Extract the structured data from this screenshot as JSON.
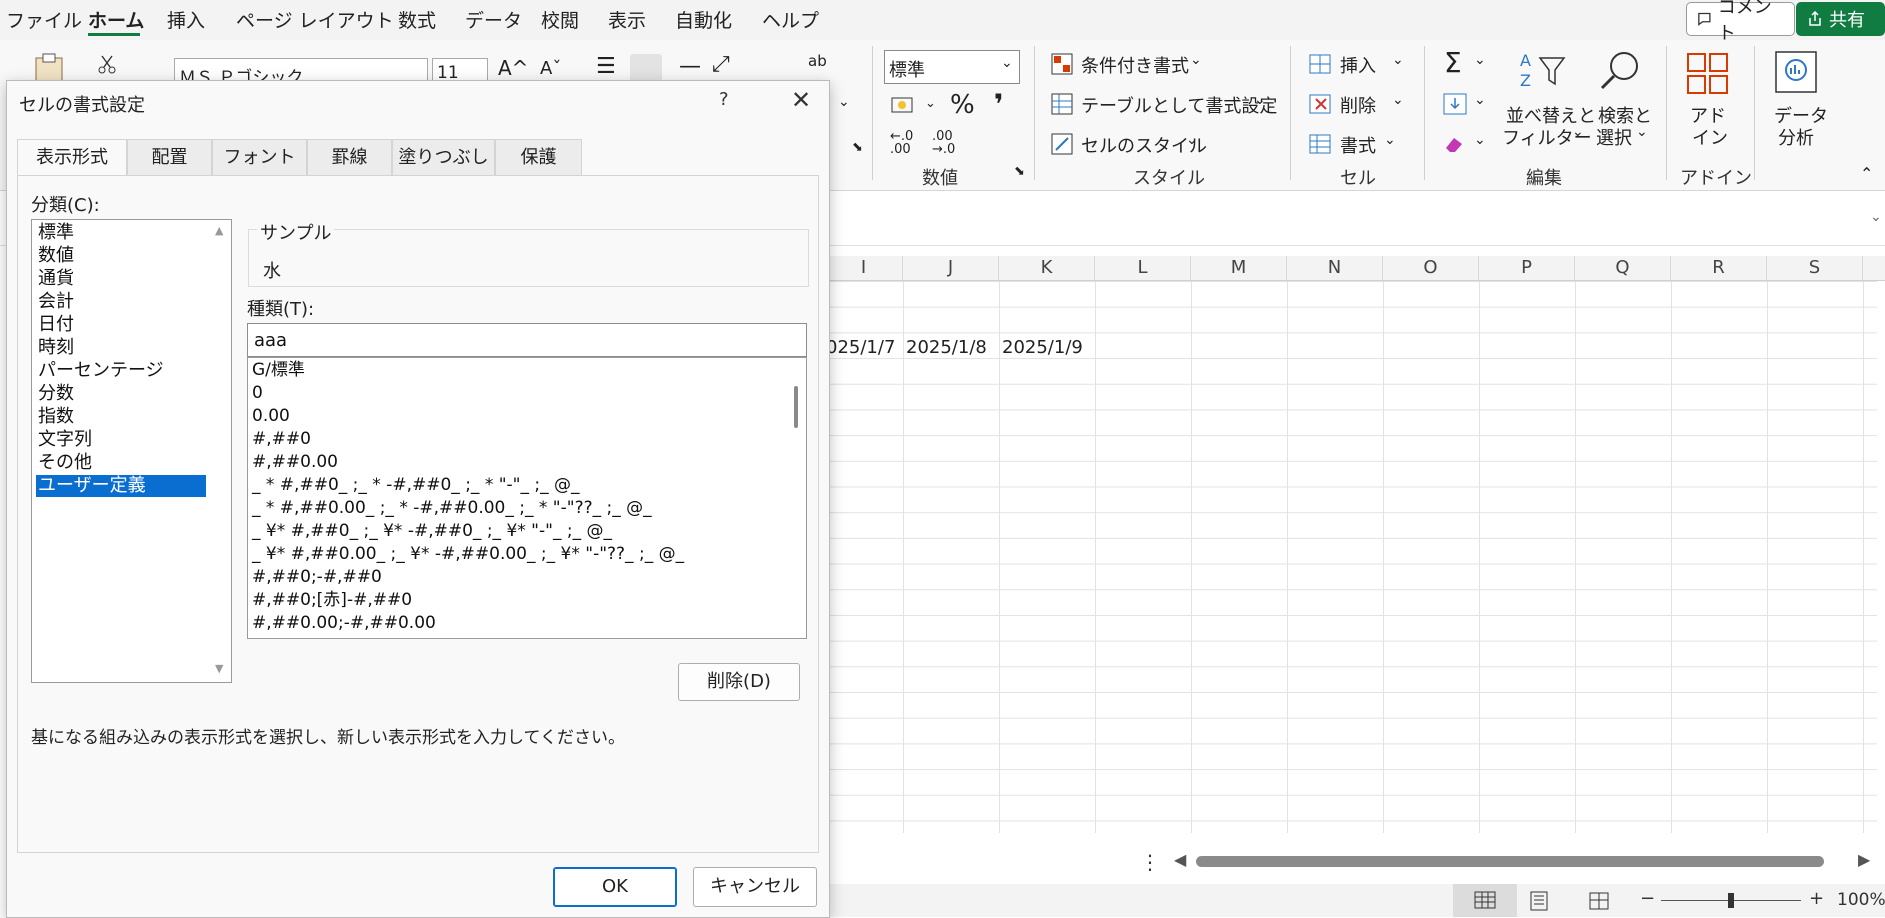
{
  "menu": {
    "items": [
      "ファイル",
      "ホーム",
      "挿入",
      "ページ レイアウト",
      "数式",
      "データ",
      "校閲",
      "表示",
      "自動化",
      "ヘルプ"
    ],
    "active": "ホーム",
    "comment_label": "コメント",
    "share_label": "共有"
  },
  "ribbon": {
    "font_name": "ＭＳ Ｐゴシック",
    "font_size": "11",
    "number_format": "標準",
    "number_group_label": "数値",
    "style": {
      "conditional": "条件付き書式",
      "as_table": "テーブルとして書式設定",
      "cell_style": "セルのスタイル",
      "group_label": "スタイル"
    },
    "cells": {
      "insert": "挿入",
      "delete": "削除",
      "format": "書式",
      "group_label": "セル"
    },
    "editing": {
      "sort_filter_1": "並べ替えと",
      "sort_filter_2": "フィルター",
      "find_select_1": "検索と",
      "find_select_2": "選択",
      "group_label": "編集"
    },
    "addin": {
      "label_1": "アド",
      "label_2": "イン",
      "group_label": "アドイン"
    },
    "data_analysis": {
      "label_1": "データ",
      "label_2": "分析"
    }
  },
  "sheet": {
    "columns": [
      "I",
      "J",
      "K",
      "L",
      "M",
      "N",
      "O",
      "P",
      "Q",
      "R",
      "S"
    ],
    "row3_values": [
      "025/1/7",
      "2025/1/8",
      "2025/1/9"
    ],
    "zoom": "100%"
  },
  "dialog": {
    "title": "セルの書式設定",
    "help": "?",
    "tabs": [
      "表示形式",
      "配置",
      "フォント",
      "罫線",
      "塗りつぶし",
      "保護"
    ],
    "selected_tab": "表示形式",
    "category_label": "分類(C):",
    "categories": [
      "標準",
      "数値",
      "通貨",
      "会計",
      "日付",
      "時刻",
      "パーセンテージ",
      "分数",
      "指数",
      "文字列",
      "その他",
      "ユーザー定義"
    ],
    "selected_category": "ユーザー定義",
    "sample_label": "サンプル",
    "sample_value": "水",
    "type_label": "種類(T):",
    "type_value": "aaa",
    "formats": [
      "G/標準",
      "0",
      "0.00",
      "#,##0",
      "#,##0.00",
      "_ * #,##0_ ;_ * -#,##0_ ;_ * \"-\"_ ;_ @_",
      "_ * #,##0.00_ ;_ * -#,##0.00_ ;_ * \"-\"??_ ;_ @_",
      "_ ¥* #,##0_ ;_ ¥* -#,##0_ ;_ ¥* \"-\"_ ;_ @_",
      "_ ¥* #,##0.00_ ;_ ¥* -#,##0.00_ ;_ ¥* \"-\"??_ ;_ @_",
      "#,##0;-#,##0",
      "#,##0;[赤]-#,##0",
      "#,##0.00;-#,##0.00"
    ],
    "delete_label": "削除(D)",
    "description": "基になる組み込みの表示形式を選択し、新しい表示形式を入力してください。",
    "ok_label": "OK",
    "cancel_label": "キャンセル"
  },
  "colors": {
    "excel_green": "#107c41",
    "selection_blue": "#0a6ed1"
  }
}
